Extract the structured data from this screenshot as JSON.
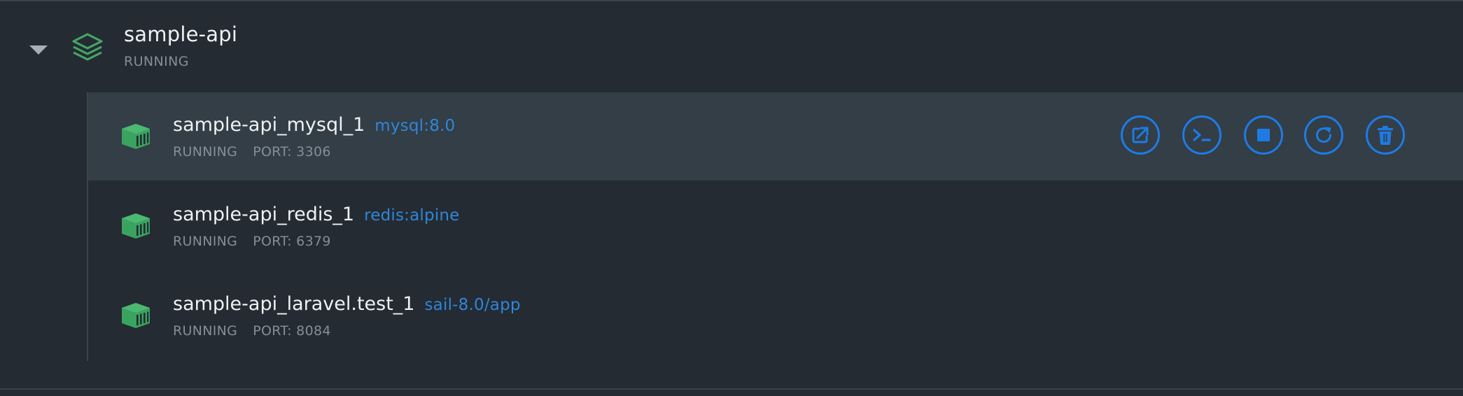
{
  "group": {
    "name": "sample-api",
    "status": "RUNNING",
    "expanded": true,
    "icon": "stack-icon"
  },
  "containers": [
    {
      "name": "sample-api_mysql_1",
      "image": "mysql:8.0",
      "status": "RUNNING",
      "port": "PORT: 3306",
      "highlighted": true
    },
    {
      "name": "sample-api_redis_1",
      "image": "redis:alpine",
      "status": "RUNNING",
      "port": "PORT: 6379",
      "highlighted": false
    },
    {
      "name": "sample-api_laravel.test_1",
      "image": "sail-8.0/app",
      "status": "RUNNING",
      "port": "PORT: 8084",
      "highlighted": false
    }
  ],
  "actions": [
    "open-in-browser-icon",
    "cli-icon",
    "stop-icon",
    "restart-icon",
    "delete-icon"
  ],
  "colors": {
    "background": "#242b32",
    "row_highlight": "#333e46",
    "accent_blue": "#1e7be6",
    "image_tag_blue": "#2f86d9",
    "container_green": "#3aa35f",
    "text_primary": "#eef2f5",
    "text_secondary": "#848e97"
  }
}
